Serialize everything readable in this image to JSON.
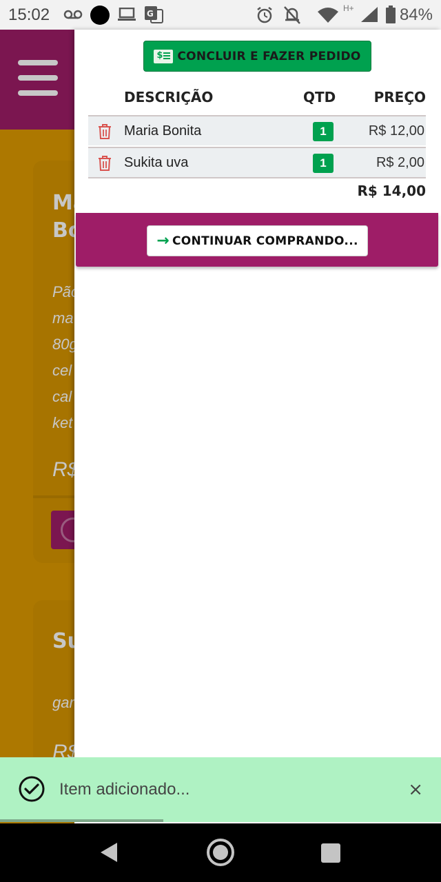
{
  "status_bar": {
    "time": "15:02",
    "battery_percent": "84%",
    "network_label": "H+"
  },
  "background_page": {
    "cards": [
      {
        "title_fragment": "Ma\nBo",
        "description_fragment": [
          "Pão",
          "ma",
          "80g",
          "cel",
          "cal",
          "ket"
        ],
        "price_fragment": "R$"
      },
      {
        "title_fragment": "Su",
        "description_fragment": [
          "gar"
        ],
        "price_fragment": "R$"
      }
    ]
  },
  "cart": {
    "checkout_label": "CONCLUIR E FAZER PEDIDO",
    "columns": {
      "description": "DESCRIÇÃO",
      "quantity": "QTD",
      "price": "PREÇO"
    },
    "items": [
      {
        "name": "Maria Bonita",
        "qty": "1",
        "price": "R$ 12,00"
      },
      {
        "name": "Sukita uva",
        "qty": "1",
        "price": "R$ 2,00"
      }
    ],
    "total": "R$ 14,00",
    "continue_label": "CONTINUAR COMPRANDO..."
  },
  "toast": {
    "message": "Item adicionado...",
    "close_symbol": "×",
    "progress_fraction": 0.37
  },
  "colors": {
    "brand_purple": "#9e1d67",
    "brand_orange": "#de9a00",
    "accent_green": "#00a14f",
    "toast_bg": "#aff2c3"
  }
}
